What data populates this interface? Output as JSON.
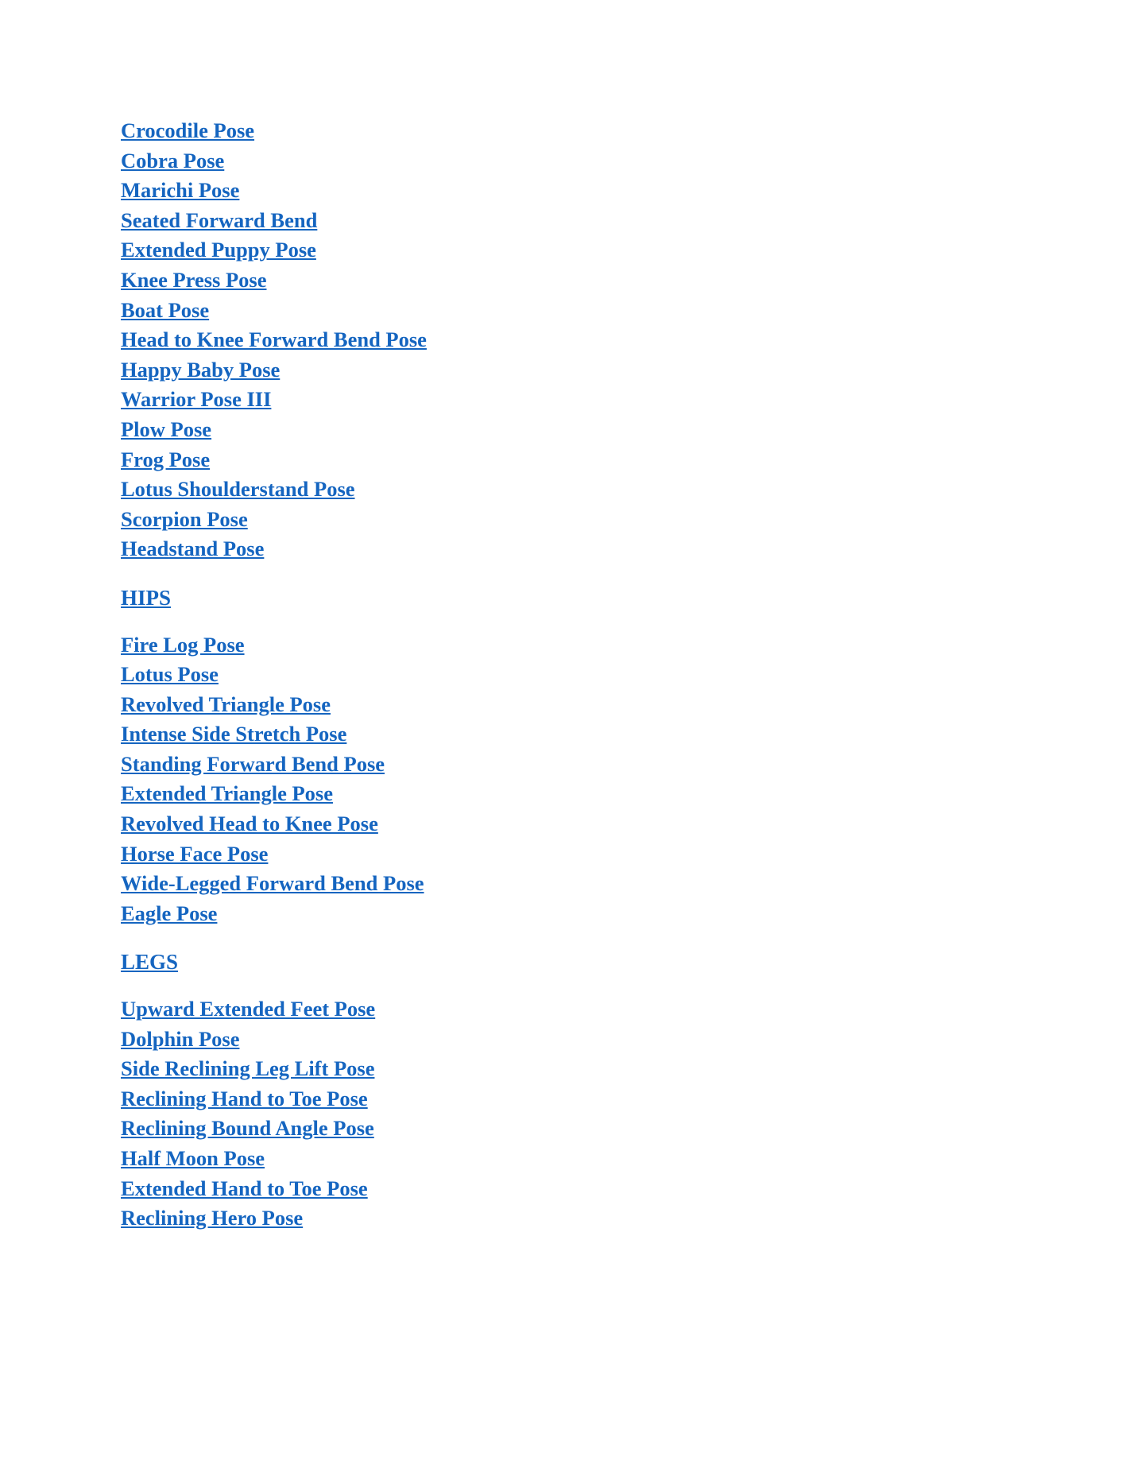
{
  "document": {
    "accent_color": "#1565c0",
    "background_color": "#ffffff",
    "sections": [
      {
        "heading": null,
        "items": [
          "Crocodile Pose",
          "Cobra Pose",
          "Marichi Pose",
          "Seated Forward Bend",
          "Extended Puppy Pose",
          "Knee Press Pose",
          "Boat Pose",
          "Head to Knee Forward Bend Pose",
          "Happy Baby Pose",
          "Warrior Pose III",
          "Plow Pose",
          "Frog Pose",
          "Lotus Shoulderstand Pose",
          "Scorpion Pose",
          "Headstand Pose"
        ]
      },
      {
        "heading": "HIPS",
        "items": [
          "Fire Log Pose",
          "Lotus Pose",
          "Revolved Triangle Pose",
          "Intense Side Stretch Pose",
          "Standing Forward Bend Pose",
          "Extended Triangle Pose",
          "Revolved Head to Knee Pose",
          "Horse Face Pose",
          "Wide-Legged Forward Bend Pose",
          "Eagle Pose"
        ]
      },
      {
        "heading": "LEGS",
        "items": [
          "Upward Extended Feet Pose",
          "Dolphin Pose",
          "Side Reclining Leg Lift Pose",
          "Reclining Hand to Toe Pose",
          "Reclining Bound Angle Pose",
          "Half Moon Pose",
          "Extended Hand to Toe Pose",
          "Reclining Hero Pose"
        ]
      }
    ]
  }
}
